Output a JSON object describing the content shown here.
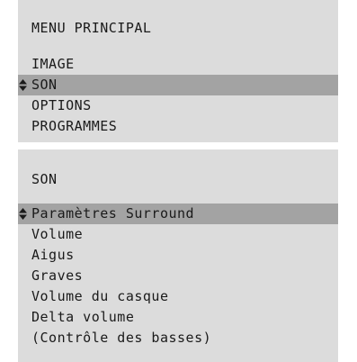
{
  "main_menu": {
    "title": "MENU PRINCIPAL",
    "items": [
      {
        "label": "IMAGE"
      },
      {
        "label": "SON"
      },
      {
        "label": "OPTIONS"
      },
      {
        "label": "PROGRAMMES"
      }
    ],
    "selected_label": "SON"
  },
  "son_menu": {
    "title": "SON",
    "items": [
      {
        "label": "Paramètres Surround"
      },
      {
        "label": "Volume"
      },
      {
        "label": "Aigus"
      },
      {
        "label": "Graves"
      },
      {
        "label": "Volume du casque"
      },
      {
        "label": "Delta volume"
      },
      {
        "label": "(Contrôle des basses)"
      }
    ],
    "selected_label": "Paramètres Surround"
  },
  "colors": {
    "panel_background": "#dcdcdc",
    "selection_highlight": "#a3a3a3",
    "text": "#1a1a1a"
  },
  "icons": {
    "selection_marker": "up-down-arrows-icon"
  }
}
